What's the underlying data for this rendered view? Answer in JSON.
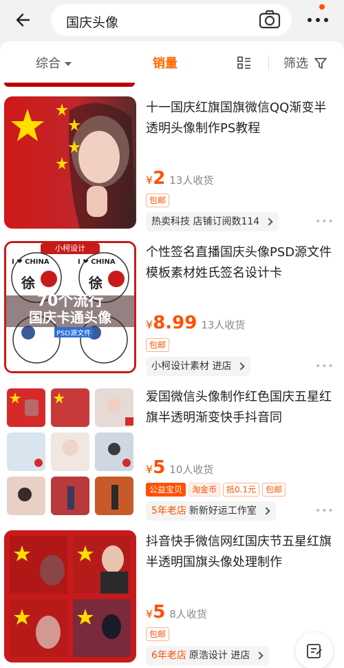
{
  "search": {
    "query": "国庆头像"
  },
  "sortbar": {
    "comprehensive": "综合",
    "sales": "销量",
    "filter": "筛选"
  },
  "colors": {
    "accent": "#ff5000",
    "sales_active": "#ff6a00"
  },
  "items": [
    {
      "title": "十一国庆红旗国旗微信QQ渐变半透明头像制作PS教程",
      "yen": "¥",
      "price": "2",
      "sold": "13人收货",
      "tags": [
        "包邮"
      ],
      "shop": "热卖科技 店铺订阅数114"
    },
    {
      "title": "个性签名直播国庆头像PSD源文件模板素材姓氏签名设计卡",
      "yen": "¥",
      "price": "8.99",
      "sold": "13人收货",
      "tags": [
        "包邮"
      ],
      "shop": "小柯设计素材 进店",
      "thumb_text": {
        "banner": "小柯设计",
        "line1": "70个流行",
        "line2": "国庆卡通头像",
        "sub": "PSD源文件",
        "china": "I ❤ CHINA",
        "name": "徐"
      }
    },
    {
      "title": "爱国微信头像制作红色国庆五星红旗半透明渐变快手抖音同",
      "yen": "¥",
      "price": "5",
      "sold": "10人收货",
      "tags": [
        "公益宝贝",
        "淘金币",
        "抵0.1元",
        "包邮"
      ],
      "shop_old": "5年老店",
      "shop": "新新好运工作室"
    },
    {
      "title": "抖音快手微信网红国庆节五星红旗半透明国旗头像处理制作",
      "yen": "¥",
      "price": "5",
      "sold": "8人收货",
      "tags": [
        "包邮"
      ],
      "shop_old": "6年老店",
      "shop": "原浩设计 进店"
    }
  ]
}
